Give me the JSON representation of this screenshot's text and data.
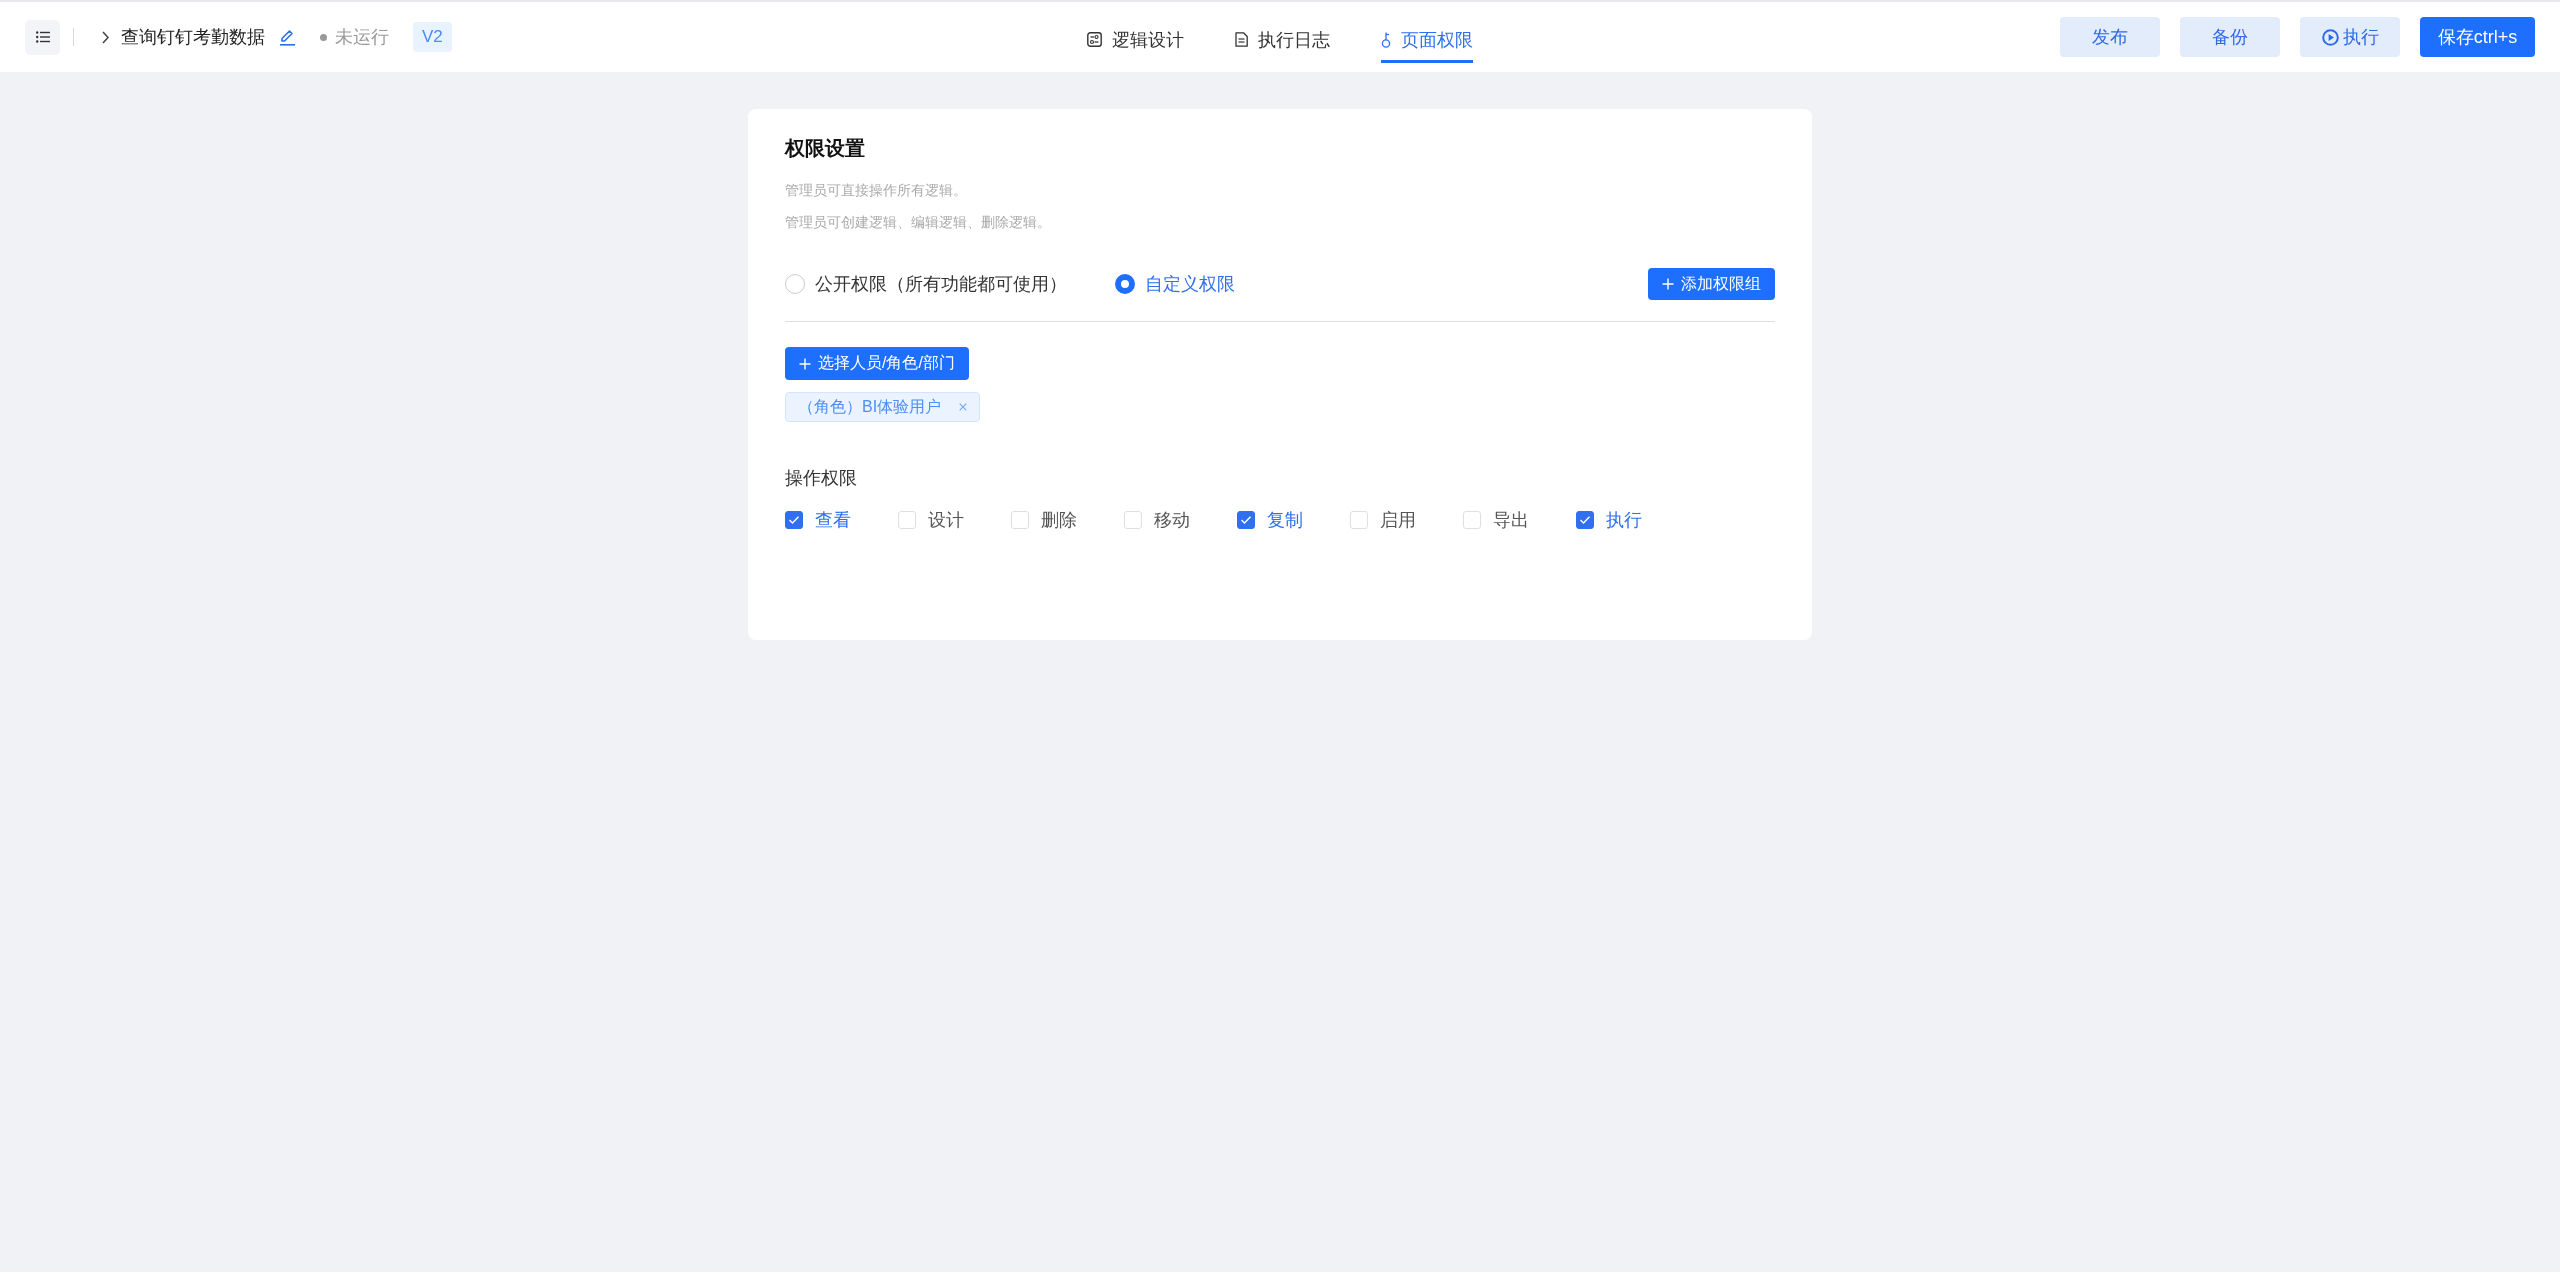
{
  "top_bar": {
    "title": "查询钉钉考勤数据",
    "status": "未运行",
    "version": "V2"
  },
  "tabs": [
    {
      "label": "逻辑设计",
      "kind": "design",
      "selected": false
    },
    {
      "label": "执行日志",
      "kind": "log",
      "selected": false
    },
    {
      "label": "页面权限",
      "kind": "permission",
      "selected": true
    }
  ],
  "actions": [
    {
      "label": "发布",
      "kind": "secondary"
    },
    {
      "label": "备份",
      "kind": "secondary"
    },
    {
      "label": "执行",
      "kind": "run"
    },
    {
      "label": "保存ctrl+s",
      "kind": "primary"
    }
  ],
  "permission_settings": {
    "title": "权限设置",
    "notes": [
      "管理员可直接操作所有逻辑。",
      "管理员可创建逻辑、编辑逻辑、删除逻辑。"
    ],
    "modes": [
      {
        "label": "公开权限（所有功能都可使用）",
        "selected": false
      },
      {
        "label": "自定义权限",
        "selected": true
      }
    ],
    "add_group_button": "添加权限组",
    "select_button": "选择人员/角色/部门",
    "members": [
      "（角色）BI体验用户"
    ],
    "operations": {
      "title": "操作权限",
      "items": [
        {
          "label": "查看",
          "checked": true
        },
        {
          "label": "设计",
          "checked": false
        },
        {
          "label": "删除",
          "checked": false
        },
        {
          "label": "移动",
          "checked": false
        },
        {
          "label": "复制",
          "checked": true
        },
        {
          "label": "启用",
          "checked": false
        },
        {
          "label": "导出",
          "checked": false
        },
        {
          "label": "执行",
          "checked": true
        }
      ]
    }
  }
}
